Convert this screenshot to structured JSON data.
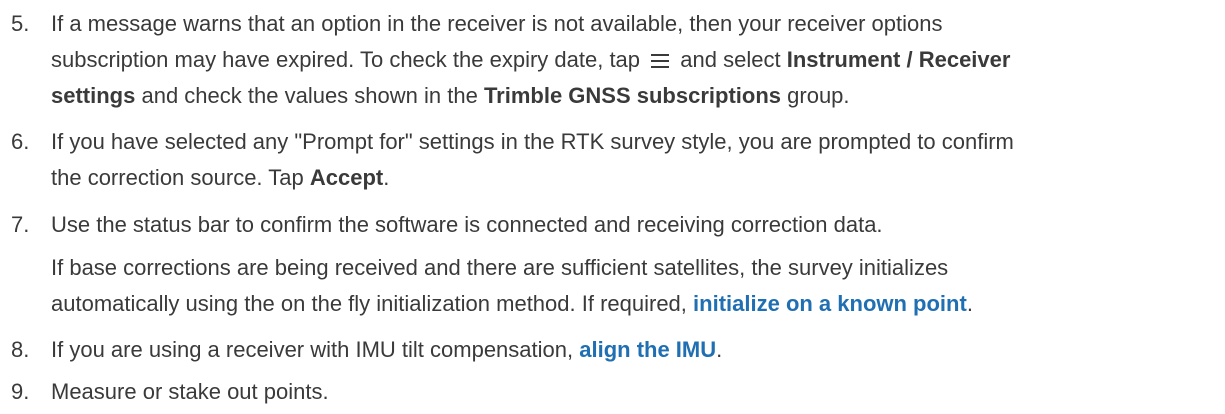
{
  "steps": [
    {
      "number": "5.",
      "lines": {
        "l1": "If a message warns that an option in the receiver is not available, then your receiver options",
        "l2_a": "subscription may have expired. To check the expiry date, tap",
        "l2_b": "and select",
        "l2_c": "Instrument / Receiver",
        "l3_a": "settings",
        "l3_b": "and check the values shown in the",
        "l3_c": "Trimble GNSS subscriptions",
        "l3_d": "group."
      },
      "icon": "menu-icon"
    },
    {
      "number": "6.",
      "lines": {
        "l1": "If you have selected any \"Prompt for\" settings in the RTK survey style, you are prompted to confirm",
        "l2_a": "the correction source. Tap",
        "l2_b": "Accept",
        "l2_c": "."
      }
    },
    {
      "number": "7.",
      "lines": {
        "l1": "Use the status bar to confirm the software is connected and receiving correction data.",
        "p1": "If base corrections are being received and there are sufficient satellites, the survey initializes",
        "p2_a": "automatically using the on the fly initialization method. If required,",
        "p2_link": "initialize on a known point",
        "p2_b": "."
      }
    },
    {
      "number": "8.",
      "lines": {
        "l1_a": "If you are using a receiver with IMU tilt compensation,",
        "l1_link": "align the IMU",
        "l1_b": "."
      }
    },
    {
      "number": "9.",
      "lines": {
        "l1": "Measure or stake out points."
      }
    }
  ],
  "colors": {
    "text": "#3a3a3a",
    "link": "#1f6fb2"
  }
}
